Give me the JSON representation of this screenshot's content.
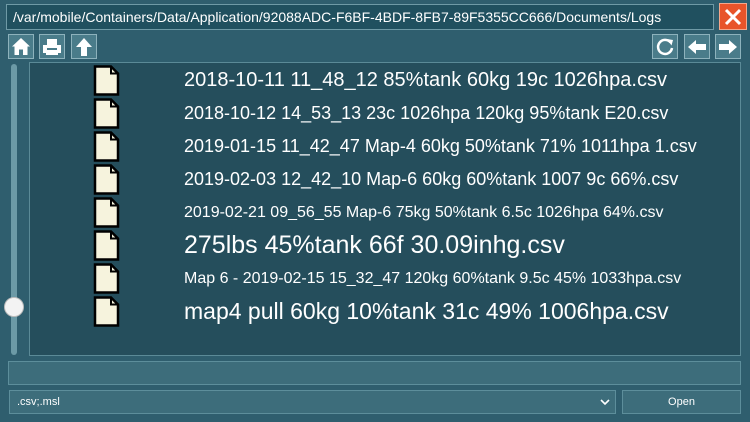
{
  "path": "/var/mobile/Containers/Data/Application/92088ADC-F6BF-4BDF-8FB7-89F5355CC666/Documents/Logs",
  "close_label": "X",
  "toolbar": {
    "left": [
      "home-icon",
      "drive-icon",
      "up-arrow-icon"
    ],
    "right": [
      "refresh-icon",
      "back-arrow-icon",
      "forward-arrow-icon"
    ]
  },
  "scroll_position": 0.85,
  "files": [
    {
      "name": "2018-10-11 11_48_12 85%tank 60kg 19c 1026hpa.csv",
      "size": "large"
    },
    {
      "name": "2018-10-12 14_53_13 23c 1026hpa 120kg 95%tank E20.csv",
      "size": "medium"
    },
    {
      "name": "2019-01-15 11_42_47 Map-4 60kg 50%tank 71% 1011hpa 1.csv",
      "size": "medium"
    },
    {
      "name": "2019-02-03 12_42_10 Map-6 60kg 60%tank 1007 9c 66%.csv",
      "size": "medium"
    },
    {
      "name": "2019-02-21 09_56_55 Map-6 75kg 50%tank 6.5c 1026hpa 64%.csv",
      "size": "small"
    },
    {
      "name": "275lbs 45%tank 66f 30.09inhg.csv",
      "size": "xlarge"
    },
    {
      "name": "Map 6 - 2019-02-15 15_32_47 120kg 60%tank 9.5c 45% 1033hpa.csv",
      "size": "small"
    },
    {
      "name": "map4 pull 60kg 10%tank 31c 49% 1006hpa.csv",
      "size": "xlarge"
    }
  ],
  "status_text": "",
  "filter": {
    "selected": ".csv;.msl"
  },
  "open_label": "Open",
  "colors": {
    "background": "#2f5e6e",
    "panel": "#254e5c",
    "close": "#e8542a",
    "file_icon_fill": "#f6f3dd"
  }
}
